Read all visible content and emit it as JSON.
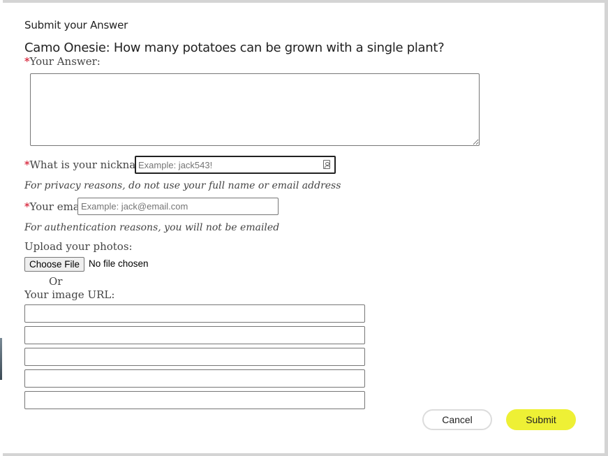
{
  "dialog": {
    "heading": "Submit your Answer",
    "question": "Camo Onesie: How many potatoes can be grown with a single plant?"
  },
  "form": {
    "required_mark": "*",
    "answer_label": "Your Answer:",
    "answer_value": "",
    "nickname_label": "What is your nickname:",
    "nickname_placeholder": "Example: jack543!",
    "nickname_hint": "For privacy reasons, do not use your full name or email address",
    "email_label": "Your email:",
    "email_placeholder": "Example: jack@email.com",
    "email_hint": "For authentication reasons, you will not be emailed",
    "upload_label": "Upload your photos:",
    "choose_file_label": "Choose File",
    "file_status": "No file chosen",
    "or_text": "Or",
    "image_url_label": "Your image URL:",
    "image_urls": [
      "",
      "",
      "",
      "",
      ""
    ]
  },
  "actions": {
    "cancel_label": "Cancel",
    "submit_label": "Submit"
  },
  "colors": {
    "submit_bg": "#eef035",
    "required": "#d0021b"
  },
  "icons": {
    "nickname_field_icon": "contact-card-icon"
  }
}
